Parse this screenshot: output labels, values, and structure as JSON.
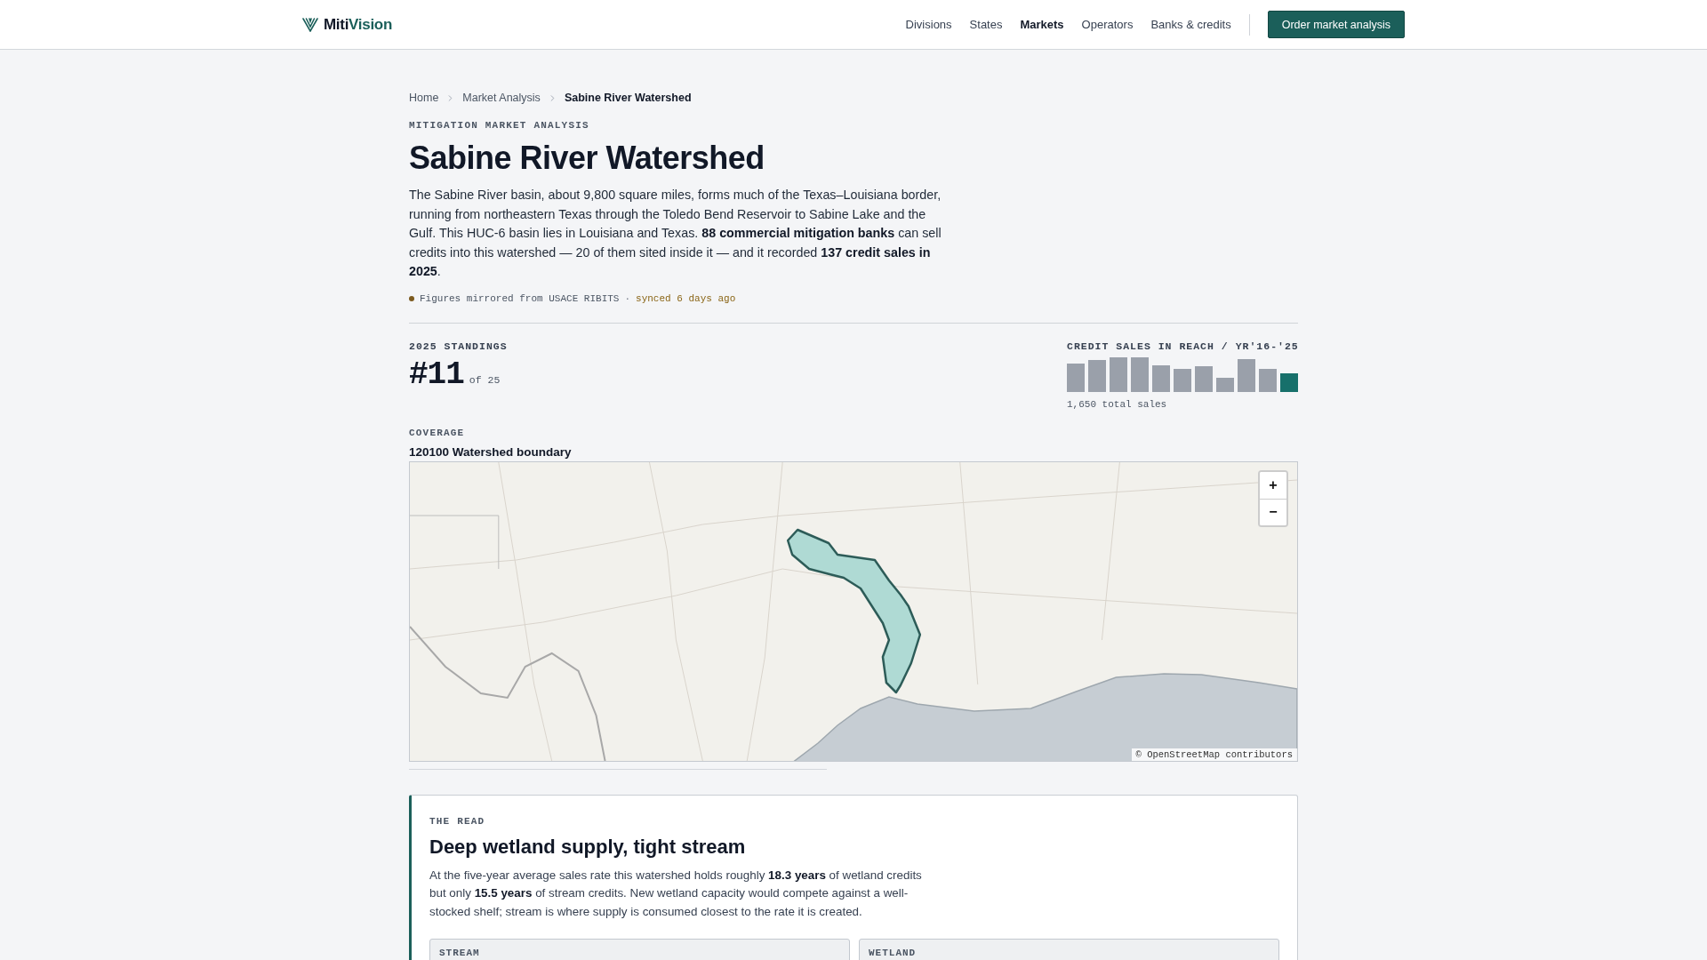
{
  "header": {
    "logo": {
      "primary": "Miti",
      "accent": "Vision"
    },
    "nav": [
      {
        "label": "Divisions",
        "selected": false
      },
      {
        "label": "States",
        "selected": false
      },
      {
        "label": "Markets",
        "selected": true
      },
      {
        "label": "Operators",
        "selected": false
      },
      {
        "label": "Banks & credits",
        "selected": false
      }
    ],
    "cta": "Order market analysis"
  },
  "breadcrumb": [
    "Home",
    "Market Analysis",
    "Sabine River Watershed"
  ],
  "eyebrow": "MITIGATION MARKET ANALYSIS",
  "title": "Sabine River Watershed",
  "description": "The Sabine River basin, about 9,800 square miles, forms much of the Texas–Louisiana border, running from northeastern Texas through the Toledo Bend Reservoir to Sabine Lake and the Gulf. This HUC-6 basin lies in Louisiana and Texas. **88 commercial mitigation banks** can sell credits into this watershed — 20 of them sited inside it — and it recorded **137 credit sales in 2025**.",
  "source": {
    "text": "Figures mirrored from USACE RIBITS",
    "separator": "·",
    "synced": "synced 6 days ago"
  },
  "standings": {
    "label": "2025 STANDINGS",
    "rank": "#11",
    "total": "of 25"
  },
  "sales": {
    "title": "CREDIT SALES IN REACH / YR",
    "range": "'16-'25",
    "total": "1,650 total sales"
  },
  "coverage": {
    "label": "COVERAGE",
    "title": "120100 Watershed boundary",
    "map": {
      "zoom_in": "+",
      "zoom_out": "−",
      "attribution": "© OpenStreetMap contributors"
    }
  },
  "read": {
    "eyebrow": "THE READ",
    "title": "Deep wetland supply, tight stream",
    "body": "At the five-year average sales rate this watershed holds roughly **18.3 years** of wetland credits but only **15.5 years** of stream credits. New wetland capacity would compete against a well-stocked shelf; stream is where supply is consumed closest to the rate it is created.",
    "panels": [
      "STREAM",
      "WETLAND"
    ]
  }
}
